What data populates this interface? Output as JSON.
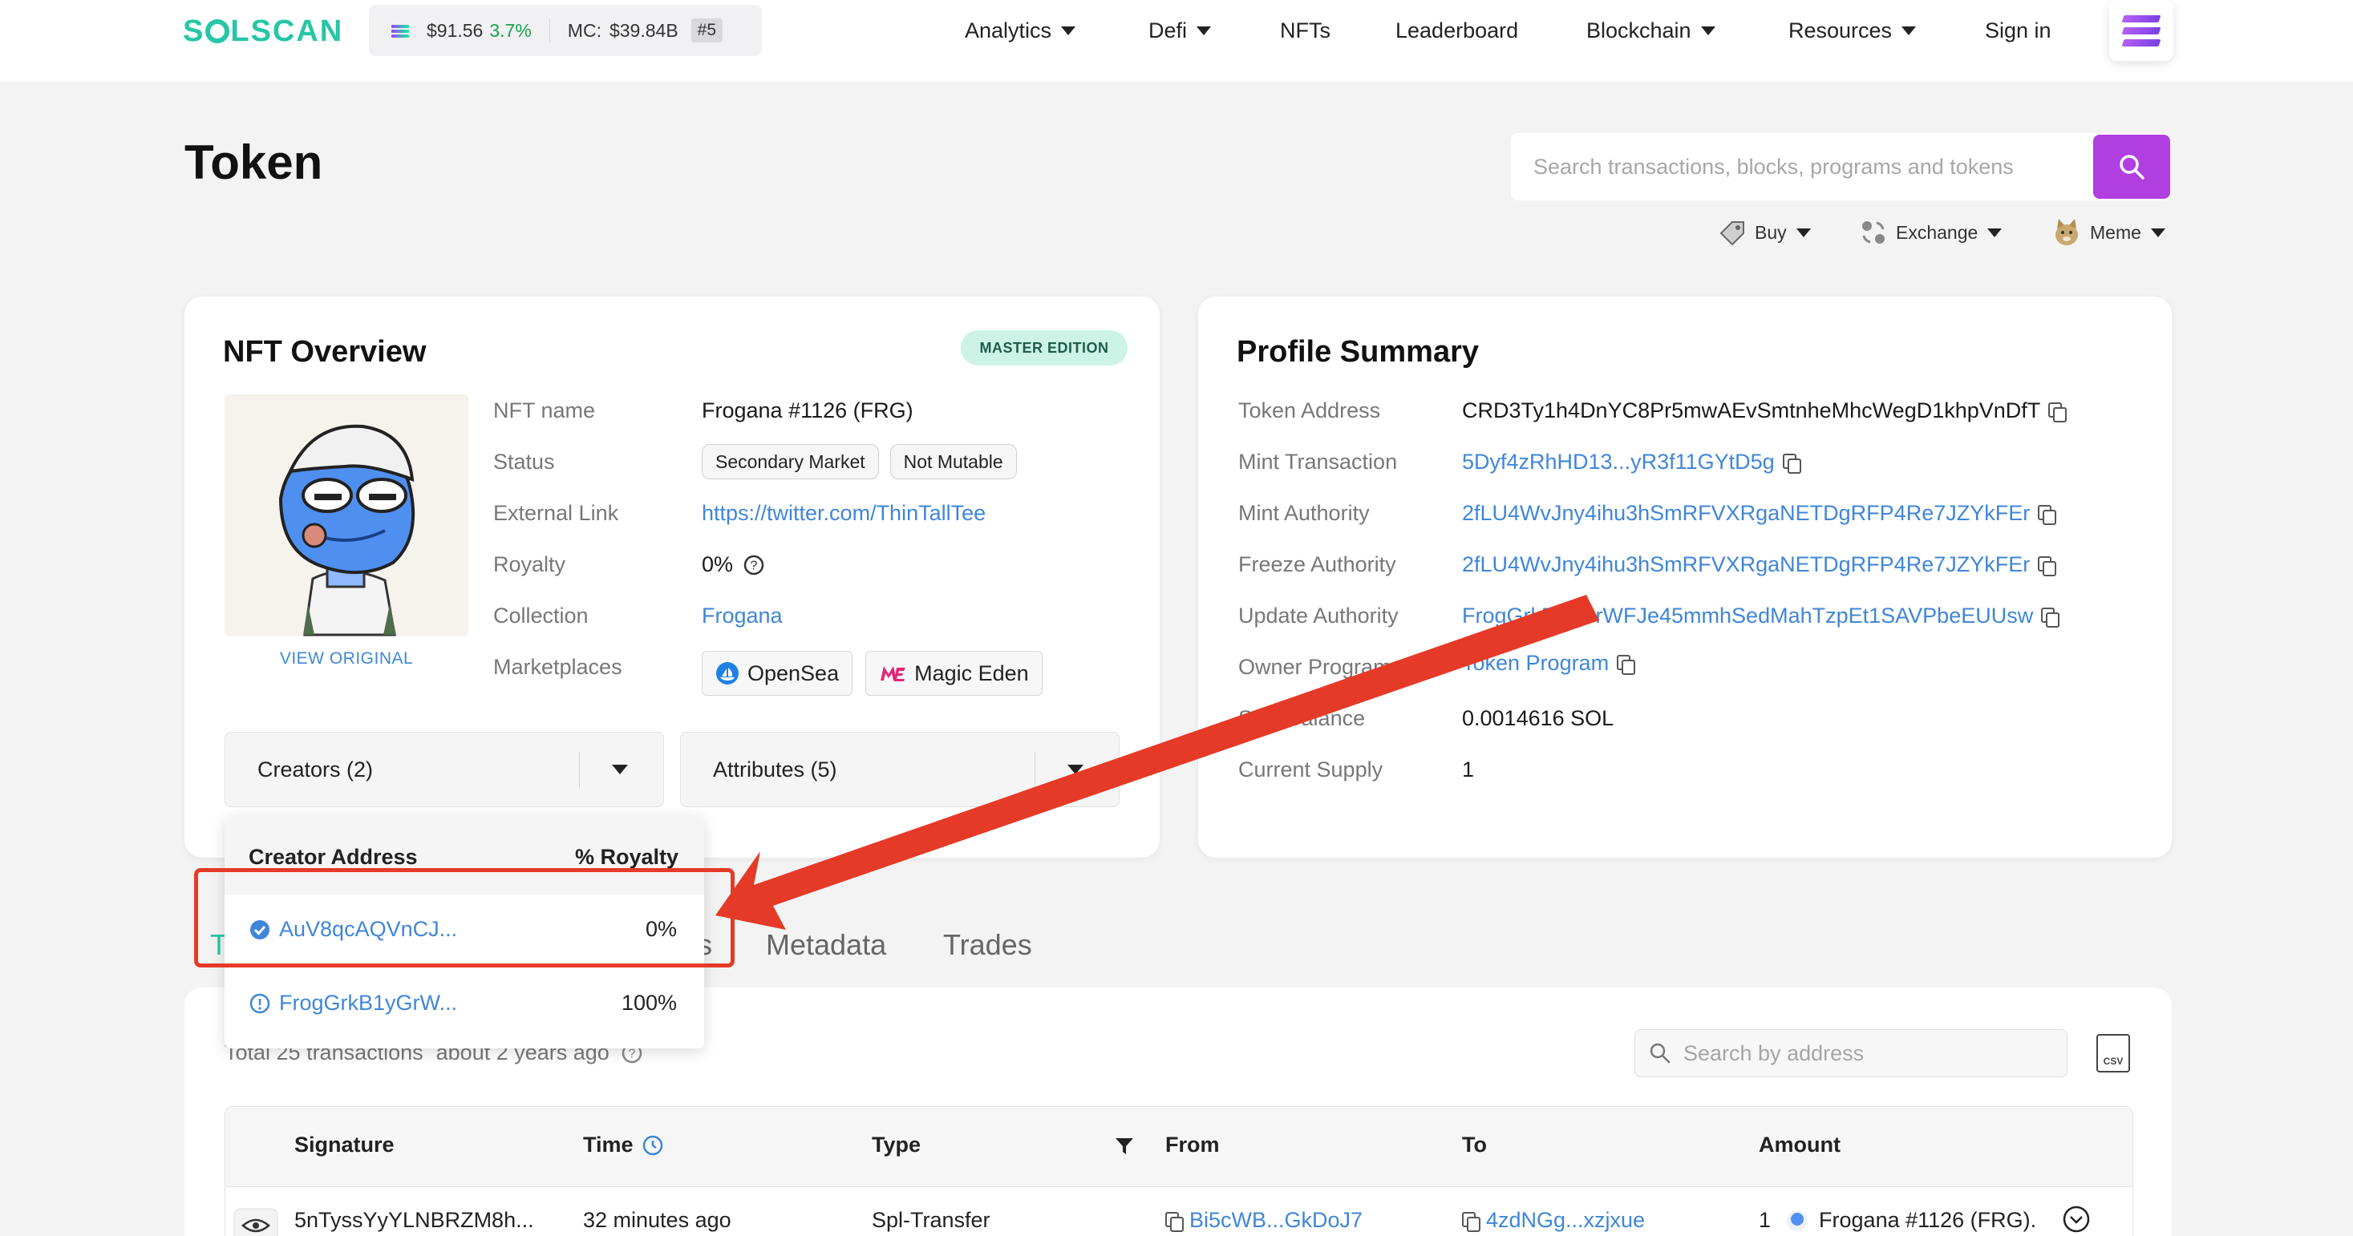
{
  "header": {
    "logo": "SOLSCAN",
    "sol_price": "$91.56",
    "sol_change": "3.7%",
    "mc_label": "MC:",
    "mc_value": "$39.84B",
    "rank": "#5",
    "nav": [
      {
        "label": "Analytics",
        "dropdown": true
      },
      {
        "label": "Defi",
        "dropdown": true
      },
      {
        "label": "NFTs",
        "dropdown": false
      },
      {
        "label": "Leaderboard",
        "dropdown": false
      },
      {
        "label": "Blockchain",
        "dropdown": true
      },
      {
        "label": "Resources",
        "dropdown": true
      },
      {
        "label": "Sign in",
        "dropdown": false
      }
    ]
  },
  "page": {
    "title": "Token",
    "search_placeholder": "Search transactions, blocks, programs and tokens",
    "subnav": {
      "buy": "Buy",
      "exchange": "Exchange",
      "meme": "Meme"
    }
  },
  "nft_overview": {
    "title": "NFT Overview",
    "badge": "MASTER EDITION",
    "view_original": "VIEW ORIGINAL",
    "labels": {
      "name": "NFT name",
      "status": "Status",
      "external_link": "External Link",
      "royalty": "Royalty",
      "collection": "Collection",
      "marketplaces": "Marketplaces"
    },
    "name": "Frogana #1126 (FRG)",
    "status_tags": [
      "Secondary Market",
      "Not Mutable"
    ],
    "external_link": "https://twitter.com/ThinTallTee",
    "royalty": "0%",
    "collection": "Frogana",
    "marketplaces": [
      "OpenSea",
      "Magic Eden"
    ],
    "creators_dropdown": "Creators (2)",
    "attributes_dropdown": "Attributes (5)"
  },
  "creators_popup": {
    "col_address": "Creator Address",
    "col_royalty": "% Royalty",
    "rows": [
      {
        "address": "AuV8qcAQVnCJ...",
        "royalty": "0%",
        "verified": true
      },
      {
        "address": "FrogGrkB1yGrW...",
        "royalty": "100%",
        "verified": false
      }
    ]
  },
  "profile_summary": {
    "title": "Profile Summary",
    "labels": {
      "token_address": "Token Address",
      "mint_tx": "Mint Transaction",
      "mint_authority": "Mint Authority",
      "freeze_authority": "Freeze Authority",
      "update_authority": "Update Authority",
      "owner_program": "Owner Program",
      "sol_balance": "SOL Balance",
      "current_supply": "Current Supply"
    },
    "token_address": "CRD3Ty1h4DnYC8Pr5mwAEvSmtnheMhcWegD1khpVnDfT",
    "mint_tx": "5Dyf4zRhHD13...yR3f11GYtD5g",
    "mint_authority": "2fLU4WvJny4ihu3hSmRFVXRgaNETDgRFP4Re7JZYkFEr",
    "freeze_authority": "2fLU4WvJny4ihu3hSmRFVXRgaNETDgRFP4Re7JZYkFEr",
    "update_authority": "FrogGrkB1yGrWFJe45mmhSedMahTzpEt1SAVPbeEUUsw",
    "owner_program": "Token Program",
    "sol_balance": "0.0014616 SOL",
    "current_supply": "1"
  },
  "tabs": {
    "metadata": "Metadata",
    "trades": "Trades"
  },
  "transactions": {
    "summary": "Total 25 transactions",
    "age": "about 2 years ago",
    "search_placeholder": "Search by address",
    "csv_label": "CSV",
    "columns": [
      "Signature",
      "Time",
      "Type",
      "From",
      "To",
      "Amount"
    ],
    "rows": [
      {
        "signature": "5nTyssYyYLNBRZM8h...",
        "time": "32 minutes ago",
        "type": "Spl-Transfer",
        "from": "Bi5cWB...GkDoJ7",
        "to": "4zdNGg...xzjxue",
        "amount": "1",
        "token": "Frogana #1126 (FRG)."
      }
    ]
  },
  "colors": {
    "accent": "#b13fe0",
    "link": "#3f86d9",
    "brand": "#26c6a6",
    "annotation": "#e53a27"
  }
}
